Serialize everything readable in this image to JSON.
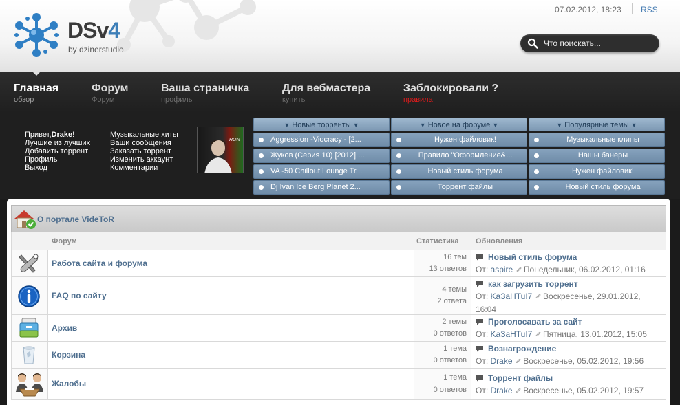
{
  "header": {
    "logo_name": "DSv",
    "logo_version": "4",
    "logo_subtitle": "by dzinerstudio",
    "datetime": "07.02.2012, 18:23",
    "rss_label": "RSS",
    "search_placeholder": "Что поискать..."
  },
  "nav": [
    {
      "title": "Главная",
      "subtitle": "обзор"
    },
    {
      "title": "Форум",
      "subtitle": "Форум"
    },
    {
      "title": "Ваша страничка",
      "subtitle": "профиль"
    },
    {
      "title": "Для вебмастера",
      "subtitle": "купить"
    },
    {
      "title": "Заблокировали ?",
      "subtitle": "правила"
    }
  ],
  "user_panel": {
    "greeting_prefix": "Привет,",
    "username": "Drake",
    "greeting_suffix": "!",
    "links_left": [
      "Лучшие из лучших",
      "Добавить торрент",
      "Профиль",
      "Выход"
    ],
    "links_right": [
      "Музыкальные хиты",
      "Ваши сообщения",
      "Заказать торрент",
      "Изменить аккаунт",
      "Комментарии"
    ],
    "avatar_text": "RON"
  },
  "columns": [
    {
      "header": "Новые торренты",
      "items": [
        "Aggression -Viocracy - [2...",
        "Жуков (Серия 10) [2012] ...",
        "VA -50 Chillout Lounge Tr...",
        "Dj Ivan Ice Berg Planet 2..."
      ]
    },
    {
      "header": "Новое на форуме",
      "items": [
        "Нужен файловик!",
        "Правило \"Оформление&...",
        "Новый стиль форума",
        "Торрент файлы"
      ]
    },
    {
      "header": "Популярные темы",
      "items": [
        "Музыкальные клипы",
        "Нашы банеры",
        "Нужен файловик!",
        "Новый стиль форума"
      ]
    }
  ],
  "forum": {
    "category_title": "О портале VideToR",
    "headers": {
      "forum": "Форум",
      "stats": "Статистика",
      "updates": "Обновления"
    },
    "rows": [
      {
        "icon": "tools-icon",
        "name": "Работа сайта и форума",
        "topics": "16 тем",
        "posts": "13 ответов",
        "last_title": "Новый стиль форума",
        "from_label": "От:",
        "last_author": "aspire",
        "last_date": "Понедельник, 06.02.2012, 01:16"
      },
      {
        "icon": "info-icon",
        "name": "FAQ по сайту",
        "topics": "4 темы",
        "posts": "2 ответа",
        "last_title": "как загрузить торрент",
        "from_label": "От:",
        "last_author": "KaЗaHTuI7",
        "last_date": "Воскресенье, 29.01.2012, 16:04"
      },
      {
        "icon": "archive-icon",
        "name": "Архив",
        "topics": "2 темы",
        "posts": "0 ответов",
        "last_title": "Проголосавать за сайт",
        "from_label": "От:",
        "last_author": "KaЗaHTuI7",
        "last_date": "Пятница, 13.01.2012, 15:05"
      },
      {
        "icon": "trash-icon",
        "name": "Корзина",
        "topics": "1 тема",
        "posts": "0 ответов",
        "last_title": "Вознагрождение",
        "from_label": "От:",
        "last_author": "Drake",
        "last_date": "Воскресенье, 05.02.2012, 19:56"
      },
      {
        "icon": "people-icon",
        "name": "Жалобы",
        "topics": "1 тема",
        "posts": "0 ответов",
        "last_title": "Торрент файлы",
        "from_label": "От:",
        "last_author": "Drake",
        "last_date": "Воскресенье, 05.02.2012, 19:57"
      }
    ]
  },
  "colors": {
    "accent": "#4f6f8f",
    "nav_bg": "#262626",
    "tab_blue": "#7f9bb6",
    "alert": "#e21b1b"
  }
}
